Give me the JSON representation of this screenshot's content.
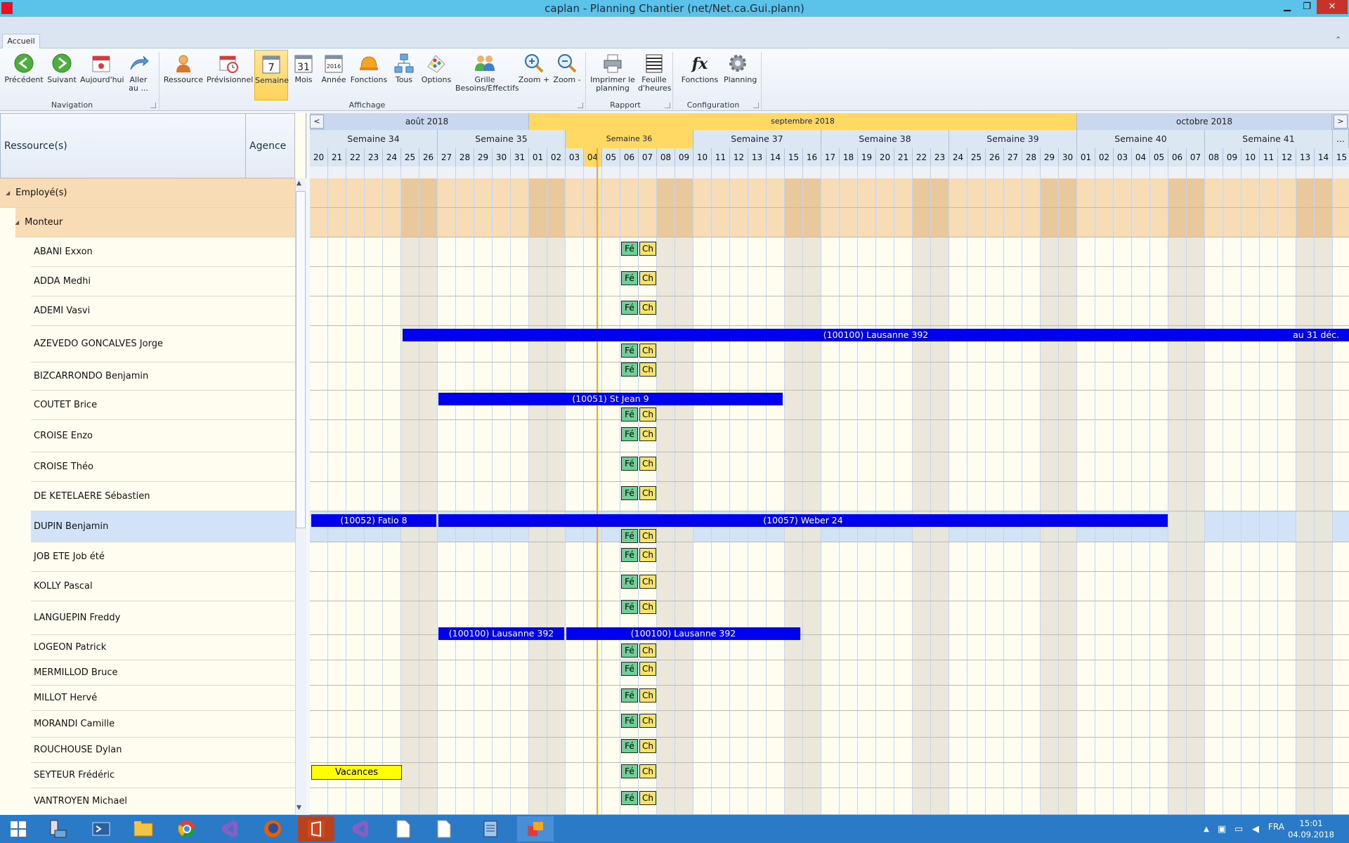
{
  "window": {
    "title": "caplan - Planning Chantier (net/Net.ca.Gui.plann)",
    "minimize": "▁",
    "restore": "❐",
    "close": "✕"
  },
  "ribbon": {
    "tab": "Accueil",
    "collapse": "⌃",
    "buttons": [
      {
        "label": "Précédent",
        "icon": "back-arrow-icon"
      },
      {
        "label": "Suivant",
        "icon": "forward-arrow-icon"
      },
      {
        "label": "Aujourd'hui",
        "icon": "calendar-today-icon"
      },
      {
        "label": "Aller au ...",
        "icon": "goto-arrow-icon"
      },
      {
        "label": "Ressource",
        "icon": "person-icon"
      },
      {
        "label": "Prévisionnel",
        "icon": "forecast-calendar-icon"
      },
      {
        "label": "Semaine",
        "icon": "week-calendar-icon",
        "glyph": "7"
      },
      {
        "label": "Mois",
        "icon": "month-calendar-icon",
        "glyph": "31"
      },
      {
        "label": "Année",
        "icon": "year-calendar-icon",
        "glyph": "2016"
      },
      {
        "label": "Fonctions",
        "icon": "helmet-icon"
      },
      {
        "label": "Tous",
        "icon": "hierarchy-icon"
      },
      {
        "label": "Options",
        "icon": "palette-icon"
      },
      {
        "label": "Grille Besoins/Effectifs",
        "icon": "team-icon"
      },
      {
        "label": "Zoom +",
        "icon": "zoom-in-icon"
      },
      {
        "label": "Zoom -",
        "icon": "zoom-out-icon"
      },
      {
        "label": "Imprimer le planning",
        "icon": "printer-icon"
      },
      {
        "label": "Feuille d'heures",
        "icon": "timesheet-icon"
      },
      {
        "label": "Fonctions",
        "icon": "fx-icon",
        "glyph": "fx"
      },
      {
        "label": "Planning",
        "icon": "gear-icon"
      }
    ],
    "groups": [
      "Navigation",
      "Affichage",
      "Rapport",
      "Configuration"
    ]
  },
  "left_panel": {
    "headers": [
      "Ressource(s)",
      "Agence"
    ],
    "group": "Employé(s)",
    "subgroup": "Monteur",
    "employees": [
      "ABANI Exxon",
      "ADDA Medhi",
      "ADEMI Vasvi",
      "AZEVEDO GONCALVES Jorge",
      "BIZCARRONDO Benjamin",
      "COUTET Brice",
      "CROISE Enzo",
      "CROISE Théo",
      "DE KETELAERE Sébastien",
      "DUPIN Benjamin",
      "JOB ETE Job été",
      "KOLLY Pascal",
      "LANGUEPIN Freddy",
      "LOGEON Patrick",
      "MERMILLOD Bruce",
      "MILLOT Hervé",
      "MORANDI Camille",
      "ROUCHOUSE Dylan",
      "SEYTEUR Frédéric",
      "VANTROYEN Michael"
    ]
  },
  "calendar": {
    "nav_prev": "<",
    "nav_next": ">",
    "months": [
      "août 2018",
      "septembre 2018",
      "octobre 2018"
    ],
    "weeks": [
      "Semaine 34",
      "Semaine 35",
      "Semaine 36",
      "Semaine 37",
      "Semaine 38",
      "Semaine 39",
      "Semaine 40",
      "Semaine 41",
      "..."
    ],
    "days": [
      "20",
      "21",
      "22",
      "23",
      "24",
      "25",
      "26",
      "27",
      "28",
      "29",
      "30",
      "31",
      "01",
      "02",
      "03",
      "04",
      "05",
      "06",
      "07",
      "08",
      "09",
      "10",
      "11",
      "12",
      "13",
      "14",
      "15",
      "16",
      "17",
      "18",
      "19",
      "20",
      "21",
      "22",
      "23",
      "24",
      "25",
      "26",
      "27",
      "28",
      "29",
      "30",
      "01",
      "02",
      "03",
      "04",
      "05",
      "06",
      "07",
      "08",
      "09",
      "10",
      "11",
      "12",
      "13",
      "14",
      "15"
    ],
    "today": "04",
    "chips": {
      "fe": "Fé",
      "ch": "Ch"
    },
    "bars": {
      "azevedo": "(100100) Lausanne 392",
      "azevedo_end": "au 31 déc.",
      "coutet": "(10051) St Jean 9",
      "dupin_a": "(10052) Fatio 8",
      "dupin_b": "(10057) Weber 24",
      "logeon_a": "(100100) Lausanne 392",
      "logeon_b": "(100100) Lausanne 392",
      "vacances": "Vacances"
    }
  },
  "taskbar": {
    "lang": "FRA",
    "time": "15:01",
    "date": "04.09.2018"
  },
  "colors": {
    "bar": "#0000f0",
    "today": "#f6a623",
    "fe": "#6fcf97",
    "ch": "#f5e46c",
    "titlebar": "#5bc3ea",
    "taskbar": "#2b7ac8"
  }
}
